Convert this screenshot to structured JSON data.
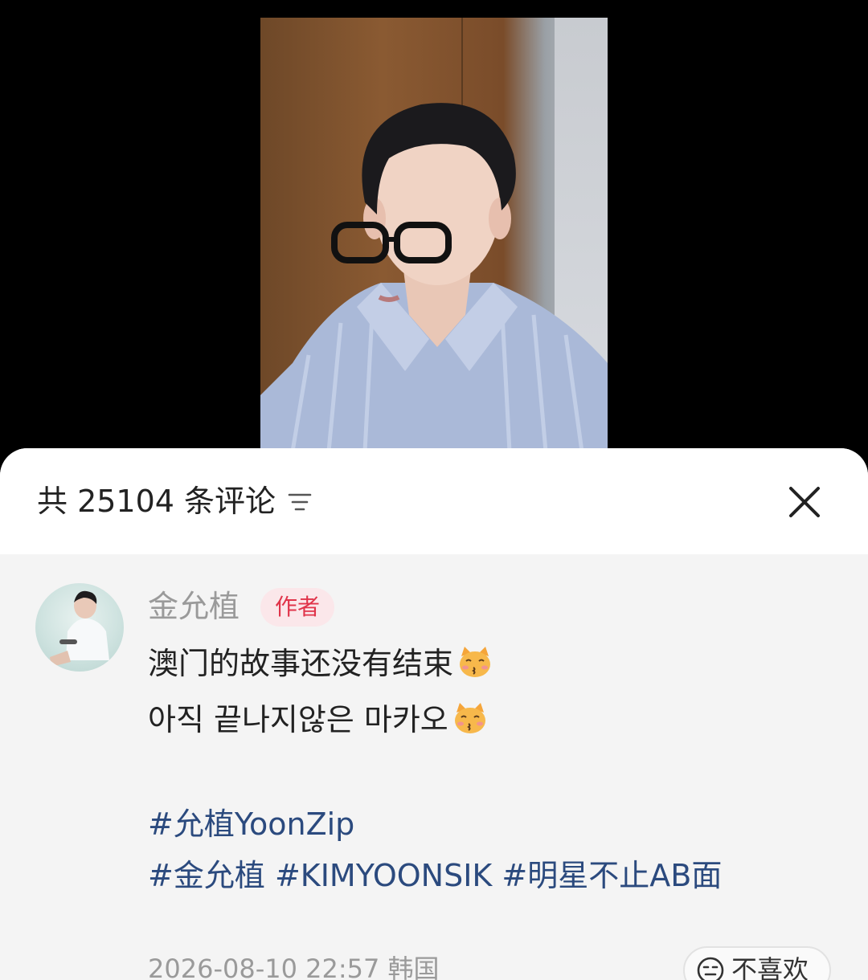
{
  "header": {
    "title": "共 25104 条评论",
    "sort_icon": "sort-lines-icon",
    "close_icon": "close-x-icon"
  },
  "comment": {
    "author_name": "金允植",
    "author_badge": "作者",
    "lines": [
      "澳门的故事还没有结束",
      "아직 끝나지않은 마카오"
    ],
    "emoji": "kissing-cat-emoji",
    "hashtags_line1": [
      "#允植YoonZip"
    ],
    "hashtags_line2": [
      "#金允植",
      "#KIMYOONSIK",
      "#明星不止AB面"
    ],
    "meta": "2026-08-10 22:57 韩国",
    "dislike_label": "不喜欢"
  },
  "colors": {
    "badge_text": "#e0344a",
    "badge_bg": "#fbe7ea",
    "hashtag": "#2b4a7e",
    "muted_text": "#9a9a9a"
  }
}
